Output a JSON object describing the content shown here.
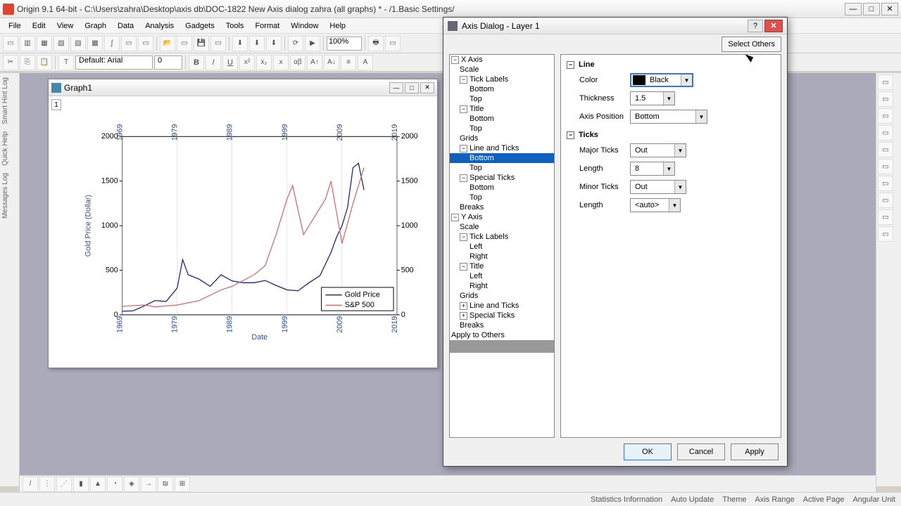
{
  "app_title": "Origin 9.1 64-bit - C:\\Users\\zahra\\Desktop\\axis db\\DOC-1822 New Axis dialog zahra (all graphs) * - /1.Basic Settings/",
  "menu": [
    "File",
    "Edit",
    "View",
    "Graph",
    "Data",
    "Analysis",
    "Gadgets",
    "Tools",
    "Format",
    "Window",
    "Help"
  ],
  "zoom": "100%",
  "font_name": "Default: Arial",
  "font_size": "0",
  "graph_window_title": "Graph1",
  "layer_label": "1",
  "dialog": {
    "title": "Axis Dialog - Layer 1",
    "select_others": "Select Others",
    "tree_x": "X Axis",
    "tree_y": "Y Axis",
    "tree_scale": "Scale",
    "tree_ticklabels": "Tick Labels",
    "tree_title": "Title",
    "tree_grids": "Grids",
    "tree_line_ticks": "Line and Ticks",
    "tree_special": "Special Ticks",
    "tree_breaks": "Breaks",
    "tree_bottom": "Bottom",
    "tree_top": "Top",
    "tree_left": "Left",
    "tree_right": "Right",
    "tree_apply": "Apply to Others",
    "group_line": "Line",
    "group_ticks": "Ticks",
    "lbl_color": "Color",
    "val_color": "Black",
    "lbl_thickness": "Thickness",
    "val_thickness": "1.5",
    "lbl_axis_pos": "Axis Position",
    "val_axis_pos": "Bottom",
    "lbl_major": "Major Ticks",
    "val_major": "Out",
    "lbl_length": "Length",
    "val_length": "8",
    "lbl_minor": "Minor Ticks",
    "val_minor": "Out",
    "val_minor_len": "<auto>",
    "btn_ok": "OK",
    "btn_cancel": "Cancel",
    "btn_apply": "Apply"
  },
  "status": [
    "Statistics Information",
    "Auto Update",
    "Theme",
    "Axis Range",
    "Active Page",
    "Angular Unit"
  ],
  "chart_data": {
    "type": "line",
    "title": "",
    "xlabel": "Date",
    "ylabel": "Gold Price (Dollar)",
    "xlim": [
      1969,
      2019
    ],
    "ylim": [
      0,
      2000
    ],
    "top_ticks": [
      1969,
      1979,
      1989,
      1999,
      2009,
      2019
    ],
    "bottom_ticks": [
      1969,
      1979,
      1989,
      1999,
      2009,
      2019
    ],
    "left_ticks": [
      0,
      500,
      1000,
      1500,
      2000
    ],
    "right_ticks": [
      0,
      500,
      1000,
      1500,
      2000
    ],
    "legend": [
      "Gold Price",
      "S&P 500"
    ],
    "series": [
      {
        "name": "Gold Price",
        "color": "#1a237e",
        "values": [
          [
            1969,
            40
          ],
          [
            1971,
            45
          ],
          [
            1973,
            100
          ],
          [
            1975,
            160
          ],
          [
            1977,
            150
          ],
          [
            1979,
            300
          ],
          [
            1980,
            620
          ],
          [
            1981,
            450
          ],
          [
            1983,
            400
          ],
          [
            1985,
            320
          ],
          [
            1987,
            450
          ],
          [
            1989,
            380
          ],
          [
            1991,
            360
          ],
          [
            1993,
            360
          ],
          [
            1995,
            385
          ],
          [
            1997,
            330
          ],
          [
            1999,
            280
          ],
          [
            2001,
            270
          ],
          [
            2003,
            360
          ],
          [
            2005,
            440
          ],
          [
            2007,
            700
          ],
          [
            2008,
            870
          ],
          [
            2009,
            1000
          ],
          [
            2010,
            1200
          ],
          [
            2011,
            1650
          ],
          [
            2012,
            1700
          ],
          [
            2013,
            1400
          ]
        ]
      },
      {
        "name": "S&P 500",
        "color": "#d46a6a",
        "values": [
          [
            1969,
            95
          ],
          [
            1973,
            110
          ],
          [
            1975,
            90
          ],
          [
            1979,
            110
          ],
          [
            1983,
            160
          ],
          [
            1987,
            280
          ],
          [
            1989,
            320
          ],
          [
            1993,
            450
          ],
          [
            1995,
            550
          ],
          [
            1997,
            900
          ],
          [
            1999,
            1300
          ],
          [
            2000,
            1450
          ],
          [
            2002,
            900
          ],
          [
            2004,
            1100
          ],
          [
            2006,
            1300
          ],
          [
            2007,
            1500
          ],
          [
            2009,
            800
          ],
          [
            2011,
            1250
          ],
          [
            2013,
            1650
          ]
        ]
      }
    ]
  }
}
